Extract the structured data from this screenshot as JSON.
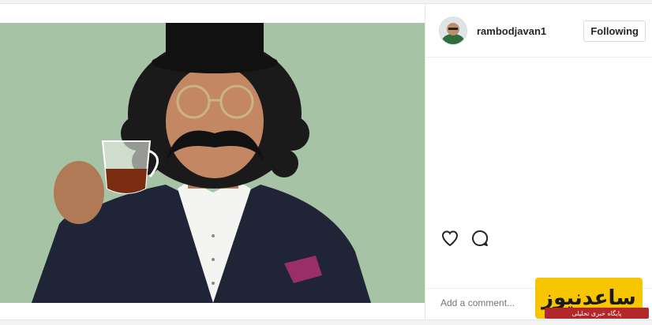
{
  "post": {
    "username": "rambodjavan1",
    "follow_label": "Following",
    "comment_placeholder": "Add a comment..."
  },
  "icons": {
    "like": "heart-icon",
    "comment": "comment-icon"
  },
  "watermark": {
    "logo_text": "ساعدنیوز",
    "tagline": "پایگاه خبری تحلیلی"
  },
  "colors": {
    "photo_background": "#a6c3a5",
    "watermark_yellow": "#f7c600",
    "watermark_red": "#b3262a"
  }
}
